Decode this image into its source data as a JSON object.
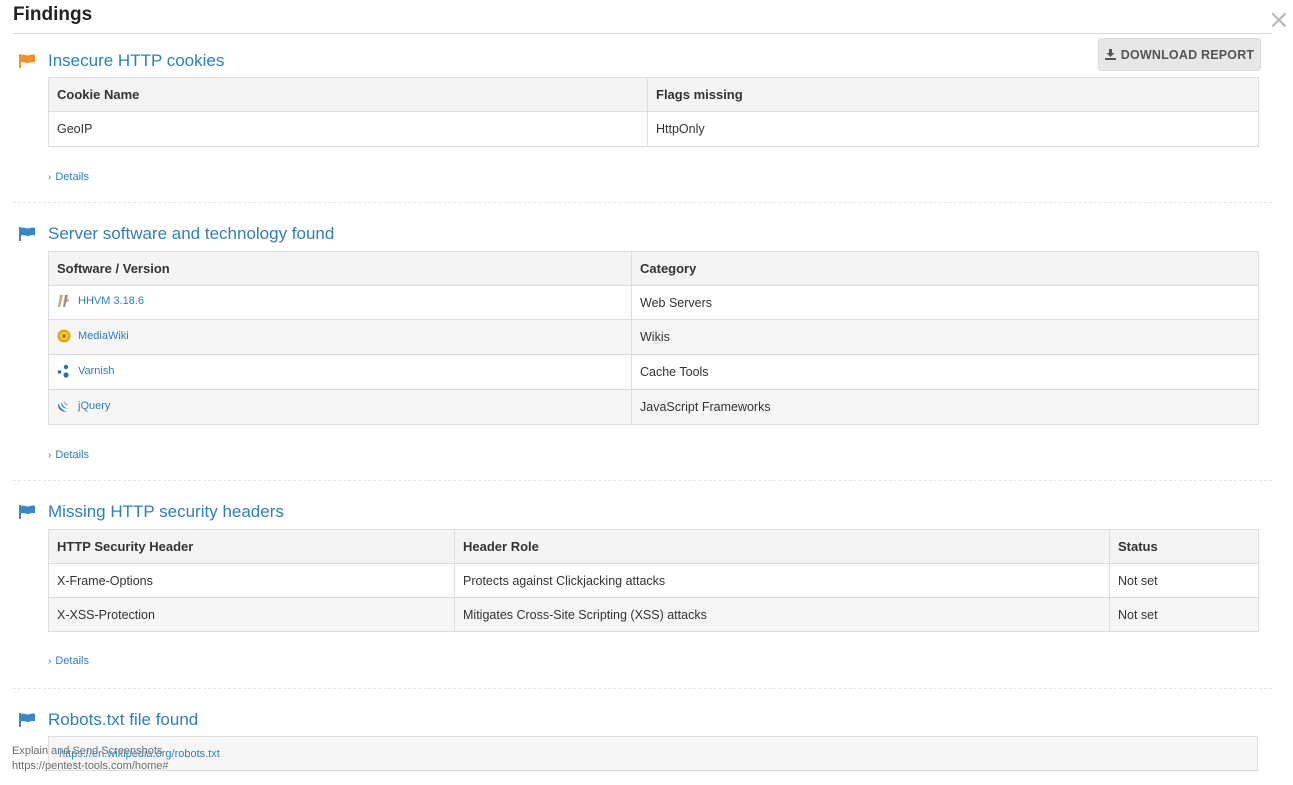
{
  "dialog": {
    "title": "Findings",
    "close_glyph": "×",
    "download_label": "DOWNLOAD REPORT"
  },
  "colors": {
    "accent_link": "#2f7fba",
    "flag_orange": "#f0912c",
    "flag_blue": "#3a87c8"
  },
  "sections": [
    {
      "title": "Insecure HTTP cookies",
      "flag_icon": "flag-icon-orange",
      "headers": [
        "Cookie Name",
        "Flags missing"
      ],
      "rows": [
        [
          "GeoIP",
          "HttpOnly"
        ]
      ],
      "details_label": "Details"
    },
    {
      "title": "Server software and technology found",
      "flag_icon": "flag-icon-blue",
      "headers": [
        "Software / Version",
        "Category"
      ],
      "rows": [
        {
          "icon": "hhvm-icon",
          "name": "HHVM 3.18.6",
          "category": "Web Servers"
        },
        {
          "icon": "mediawiki-icon",
          "name": "MediaWiki",
          "category": "Wikis"
        },
        {
          "icon": "varnish-icon",
          "name": "Varnish",
          "category": "Cache Tools"
        },
        {
          "icon": "jquery-icon",
          "name": "jQuery",
          "category": "JavaScript Frameworks"
        }
      ],
      "details_label": "Details"
    },
    {
      "title": "Missing HTTP security headers",
      "flag_icon": "flag-icon-blue",
      "headers": [
        "HTTP Security Header",
        "Header Role",
        "Status"
      ],
      "rows": [
        [
          "X-Frame-Options",
          "Protects against Clickjacking attacks",
          "Not set"
        ],
        [
          "X-XSS-Protection",
          "Mitigates Cross-Site Scripting (XSS) attacks",
          "Not set"
        ]
      ],
      "details_label": "Details"
    },
    {
      "title": "Robots.txt file found",
      "flag_icon": "flag-icon-blue",
      "link": "https://en.wikipedia.org/robots.txt"
    }
  ],
  "overlay": {
    "line1": "Explain and Send Screenshots",
    "line2": "https://pentest-tools.com/home#"
  }
}
